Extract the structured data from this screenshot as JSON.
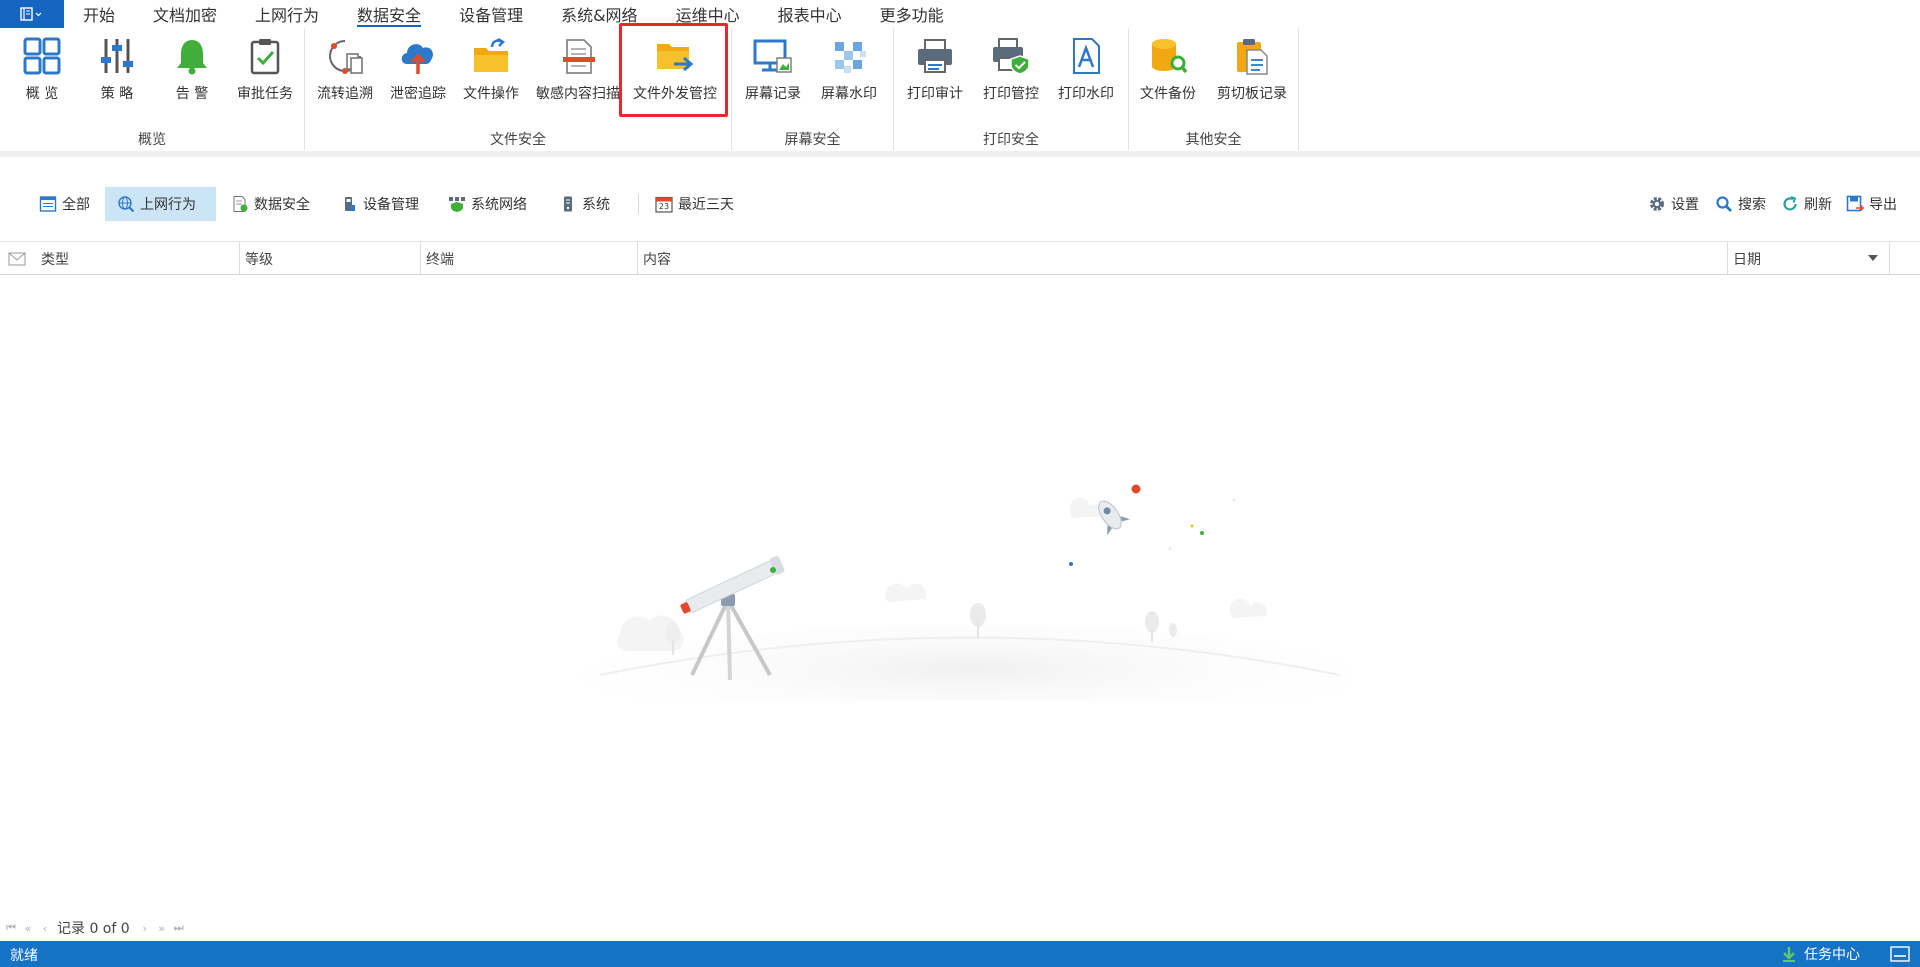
{
  "menu": {
    "tabs": [
      "开始",
      "文档加密",
      "上网行为",
      "数据安全",
      "设备管理",
      "系统&网络",
      "运维中心",
      "报表中心",
      "更多功能"
    ],
    "active_index": 3
  },
  "ribbon": {
    "groups": {
      "overview": {
        "label": "概览",
        "buttons": {
          "overview": "概 览",
          "policy": "策 略",
          "alert": "告 警",
          "approval": "审批任务"
        }
      },
      "file_security": {
        "label": "文件安全",
        "buttons": {
          "flow_trace": "流转追溯",
          "leak_trace": "泄密追踪",
          "file_ops": "文件操作",
          "sensitive_scan": "敏感内容扫描",
          "outgoing_control": "文件外发管控"
        }
      },
      "screen_security": {
        "label": "屏幕安全",
        "buttons": {
          "screen_record": "屏幕记录",
          "screen_watermark": "屏幕水印"
        }
      },
      "print_security": {
        "label": "打印安全",
        "buttons": {
          "print_audit": "打印审计",
          "print_control": "打印管控",
          "print_watermark": "打印水印"
        }
      },
      "other_security": {
        "label": "其他安全",
        "buttons": {
          "file_backup": "文件备份",
          "clipboard_log": "剪切板记录"
        }
      }
    },
    "highlighted_button": "文件外发管控",
    "highlight_color": "#e8292b"
  },
  "filters": {
    "all": "全部",
    "web": "上网行为",
    "data": "数据安全",
    "device": "设备管理",
    "network": "系统网络",
    "system": "系统",
    "recent": "最近三天",
    "calendar_day": "23",
    "selected": "上网行为"
  },
  "actions": {
    "settings": "设置",
    "search": "搜索",
    "refresh": "刷新",
    "export": "导出"
  },
  "table": {
    "columns": {
      "type": "类型",
      "level": "等级",
      "terminal": "终端",
      "content": "内容",
      "date": "日期"
    },
    "rows": []
  },
  "pager": {
    "text": "记录 0 of 0"
  },
  "status": {
    "text": "就绪",
    "task_center": "任务中心"
  },
  "colors": {
    "accent": "#1565c0",
    "statusbar": "#1672c4",
    "selected_filter": "#cce5f6"
  }
}
